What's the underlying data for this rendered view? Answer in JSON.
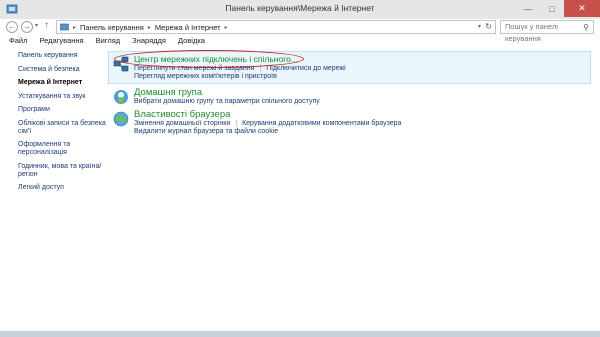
{
  "window": {
    "title": "Панель керування\\Мережа й Інтернет"
  },
  "navbar": {
    "back_label": "←",
    "forward_label": "→",
    "up_label": "↑",
    "breadcrumb": [
      "Панель керування",
      "Мережа й Інтернет"
    ],
    "search_placeholder": "Пошук у панелі керування"
  },
  "menubar": {
    "items": [
      "Файл",
      "Редагування",
      "Вигляд",
      "Знаряддя",
      "Довідка"
    ]
  },
  "sidebar": {
    "items": [
      "Панель керування",
      "Система й безпека",
      "Мережа й Інтернет",
      "Устаткування та звук",
      "Програми",
      "Облікові записи та безпека сім'ї",
      "Оформлення та персоналізація",
      "Годинник, мова та країна/регіон",
      "Легкий доступ"
    ]
  },
  "categories": [
    {
      "title": "Центр мережних підключень і спільного...",
      "links": [
        "Переглянути стан мережі й завдання",
        "Підключитися до мережі",
        "Перегляд мережних комп'ютерів і пристроїв"
      ]
    },
    {
      "title": "Домашня група",
      "links": [
        "Вибрати домашню групу та параметри спільного доступу"
      ]
    },
    {
      "title": "Властивості браузера",
      "links": [
        "Змінення домашньої сторінки",
        "Керування додатковими компонентами браузера",
        "Видалити журнал браузера та файли cookie"
      ]
    }
  ],
  "colors": {
    "category_title": "#1e8c2b",
    "link": "#1e3c78",
    "highlight_bg": "#eaf5fc",
    "annotation_oval": "#c0282a"
  },
  "icons": {
    "network_center": "network-globe-icon",
    "homegroup": "homegroup-icon",
    "browser": "internet-options-globe-icon"
  }
}
